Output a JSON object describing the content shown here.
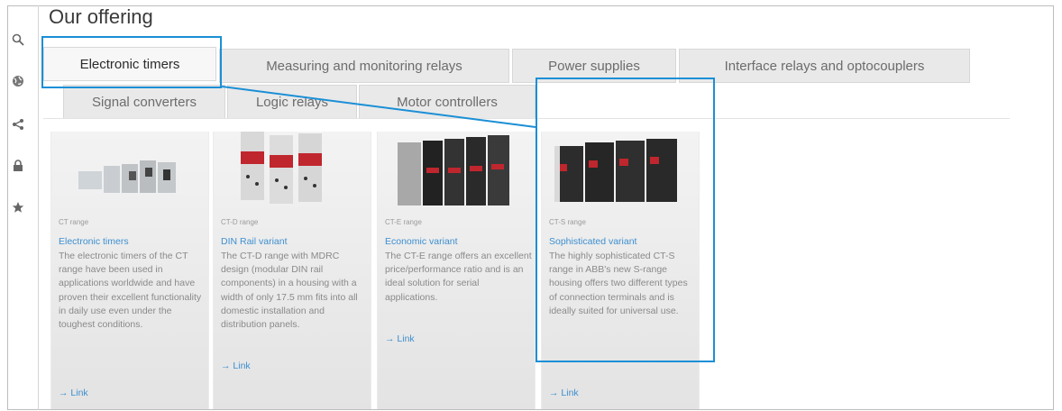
{
  "page": {
    "title": "Our offering"
  },
  "sidebar": {
    "icons": [
      "search-icon",
      "globe-icon",
      "share-icon",
      "lock-icon",
      "star-icon"
    ]
  },
  "tabs": [
    {
      "label": "Electronic timers",
      "active": true
    },
    {
      "label": "Measuring and monitoring relays"
    },
    {
      "label": "Power supplies"
    },
    {
      "label": "Interface relays and optocouplers"
    },
    {
      "label": "Signal converters"
    },
    {
      "label": "Logic relays"
    },
    {
      "label": "Motor controllers"
    }
  ],
  "cards": [
    {
      "range": "CT range",
      "heading": "Electronic timers",
      "description": "The electronic timers of the CT range have been used in applications worldwide and have proven their excellent functionality in daily use even under the toughest conditions.",
      "link": "→ Link"
    },
    {
      "range": "CT-D range",
      "heading": "DIN Rail variant",
      "description": "The CT-D range with MDRC design (modular DIN rail components) in a housing with a width of only 17.5 mm fits into all domestic installation and distribution panels.",
      "link": "→ Link"
    },
    {
      "range": "CT-E range",
      "heading": "Economic variant",
      "description": "The CT-E range offers an excellent price/performance ratio and is an ideal solution for serial applications.",
      "link": "→ Link"
    },
    {
      "range": "CT-S range",
      "heading": "Sophisticated variant",
      "description": "The highly sophisticated CT-S range in ABB's new S-range housing offers two different types of connection terminals and is ideally suited for universal use.",
      "link": "→ Link"
    }
  ],
  "colors": {
    "highlight": "#1b8fd6",
    "link": "#3d8fd0",
    "tab_bg": "#e9e9e9"
  }
}
